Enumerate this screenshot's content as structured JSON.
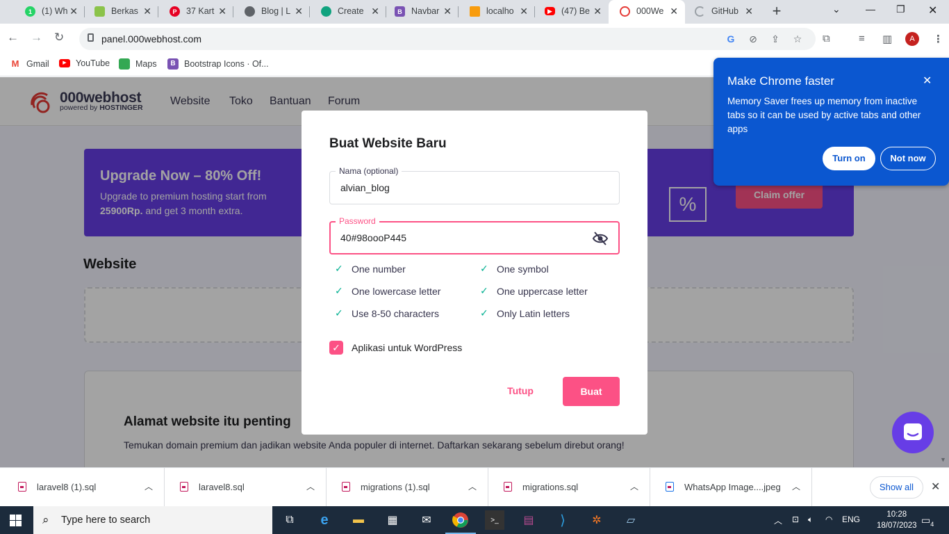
{
  "browser": {
    "tabs": [
      {
        "title": "(1) Wh",
        "icon": "whatsapp-icon",
        "color": "#25d366",
        "badge": "1"
      },
      {
        "title": "Berkas",
        "icon": "folder-crest-icon",
        "color": "#8bc34a"
      },
      {
        "title": "37 Kart",
        "icon": "pinterest-icon",
        "color": "#e60023"
      },
      {
        "title": "Blog | L",
        "icon": "globe-icon",
        "color": "#5f6368"
      },
      {
        "title": "Create",
        "icon": "chatgpt-icon",
        "color": "#10a37f"
      },
      {
        "title": "Navbar",
        "icon": "bootstrap-icon",
        "color": "#7952b3",
        "badge": "B"
      },
      {
        "title": "localho",
        "icon": "phpmyadmin-icon",
        "color": "#f89c0e"
      },
      {
        "title": "(47) Be",
        "icon": "youtube-icon",
        "color": "#ff0000"
      },
      {
        "title": "000We",
        "icon": "000webhost-icon",
        "color": "#e53935",
        "active": true
      },
      {
        "title": "GitHub",
        "icon": "loading-icon",
        "color": "#5f6368"
      }
    ],
    "url": "panel.000webhost.com",
    "profile_initial": "A",
    "bookmarks": [
      {
        "label": "Gmail",
        "icon": "gmail-icon",
        "color": "#ea4335"
      },
      {
        "label": "YouTube",
        "icon": "youtube-icon",
        "color": "#ff0000"
      },
      {
        "label": "Maps",
        "icon": "maps-icon",
        "color": "#34a853"
      },
      {
        "label": "Bootstrap Icons · Of...",
        "icon": "bootstrap-icon",
        "color": "#7952b3"
      }
    ]
  },
  "site": {
    "logo_name": "000webhost",
    "logo_sub_prefix": "powered by ",
    "logo_sub_brand": "HOSTINGER",
    "nav": [
      "Website",
      "Toko",
      "Bantuan",
      "Forum"
    ],
    "promo": {
      "title": "Upgrade Now – 80% Off!",
      "text": "Upgrade to premium hosting start from",
      "price": "25900Rp.",
      "text_after": " and get 3 month extra.",
      "claim_label": "Claim offer",
      "percent_symbol": "%"
    },
    "section_title": "Website",
    "card": {
      "title": "Alamat website itu penting",
      "text": "Temukan domain premium dan jadikan website Anda populer di internet. Daftarkan sekarang sebelum direbut orang!"
    }
  },
  "modal": {
    "title": "Buat Website Baru",
    "name_label": "Nama (optional)",
    "name_value": "alvian_blog",
    "password_label": "Password",
    "password_value": "40#98oooP445",
    "requirements": [
      "One number",
      "One symbol",
      "One lowercase letter",
      "One uppercase letter",
      "Use 8-50 characters",
      "Only Latin letters"
    ],
    "wordpress_label": "Aplikasi untuk WordPress",
    "wordpress_checked": true,
    "close_label": "Tutup",
    "create_label": "Buat",
    "accent_color": "#fc5185"
  },
  "chrome_bubble": {
    "title": "Make Chrome faster",
    "text": "Memory Saver frees up memory from inactive tabs so it can be used by active tabs and other apps",
    "primary": "Turn on",
    "secondary": "Not now"
  },
  "downloads": {
    "items": [
      "laravel8 (1).sql",
      "laravel8.sql",
      "migrations (1).sql",
      "migrations.sql",
      "WhatsApp Image....jpeg"
    ],
    "show_all": "Show all"
  },
  "taskbar": {
    "search_placeholder": "Type here to search",
    "language": "ENG",
    "time": "10:28",
    "date": "18/07/2023",
    "notification_count": "4",
    "apps": [
      "task-view-icon",
      "edge-icon",
      "file-explorer-icon",
      "store-icon",
      "mail-icon",
      "chrome-icon",
      "terminal-icon",
      "winrar-icon",
      "vscode-icon",
      "xampp-icon",
      "notepad-icon"
    ]
  }
}
